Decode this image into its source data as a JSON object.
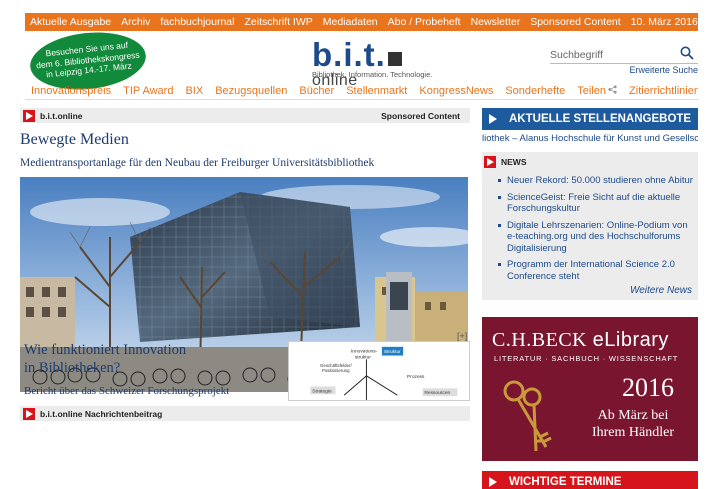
{
  "top_nav": {
    "items": [
      "Aktuelle Ausgabe",
      "Archiv",
      "fachbuchjournal",
      "Zeitschrift IWP",
      "Mediadaten",
      "Abo / Probeheft",
      "Newsletter",
      "Sponsored Content"
    ],
    "date": "10. März 2016"
  },
  "promo": {
    "line1": "Besuchen Sie uns auf",
    "line2": "dem 6. Bibliothekskongress",
    "line3": "in Leipzig 14.-17. März"
  },
  "logo": {
    "main": "b.i.t.",
    "suffix": "online",
    "tagline": "Bibliothek. Information. Technologie."
  },
  "search": {
    "placeholder": "Suchbegriff",
    "advanced_link": "Erweiterte Suche"
  },
  "sub_nav": {
    "items": [
      "Innovationspreis",
      "TIP Award",
      "BIX",
      "Bezugsquellen",
      "Bücher",
      "Stellenmarkt",
      "KongressNews",
      "Sonderhefte",
      "Teilen",
      "Zitierrichtlinien"
    ]
  },
  "article1": {
    "section": "b.i.t.online",
    "section_right": "Sponsored Content",
    "title": "Bewegte Medien",
    "subtitle": "Medientransportanlage für den Neubau der Freiburger Universitätsbibliothek"
  },
  "article2": {
    "section": "b.i.t.online Nachrichtenbeitrag",
    "expand": "[+]",
    "title_line1": "Wie funktioniert Innovation",
    "title_line2": "in Bibliotheken?",
    "subtitle": "Bericht über das Schweizer Forschungsprojekt",
    "diagram_labels": {
      "innovation": "Innovations-\nstruktur",
      "struktur": "Struktur",
      "positionierung": "Geschäftsfelder/\nPositionierung",
      "strategie": "Strategie",
      "prozess": "Prozess",
      "ressourcen": "Ressourcen"
    }
  },
  "jobs": {
    "heading": "AKTUELLE STELLENANGEBOTE",
    "ticker": "liothek – Alanus Hochschule für Kunst und Gesellschaft"
  },
  "news": {
    "heading": "NEWS",
    "items": [
      "Neuer Rekord: 50.000 studieren ohne Abitur",
      "ScienceGeist: Freie Sicht auf die aktuelle Forschungskultur",
      "Digitale Lehrszenarien: Online-Podium von e-teaching.org und des Hochschulforums Digitalisierung",
      "Programm der International Science 2.0 Conference steht"
    ],
    "more": "Weitere News"
  },
  "ad": {
    "brand": "C.H.BECK",
    "brand_suffix": "eLibrary",
    "tagline": "LITERATUR · SACHBUCH · WISSENSCHAFT",
    "year": "2016",
    "when_line1": "Ab März bei",
    "when_line2": "Ihrem Händler"
  },
  "events": {
    "heading": "WICHTIGE TERMINE"
  },
  "colors": {
    "orange": "#e8751d",
    "blue": "#1e5a9e",
    "red": "#d6141b",
    "green": "#128a3c",
    "maroon": "#7a1530"
  }
}
